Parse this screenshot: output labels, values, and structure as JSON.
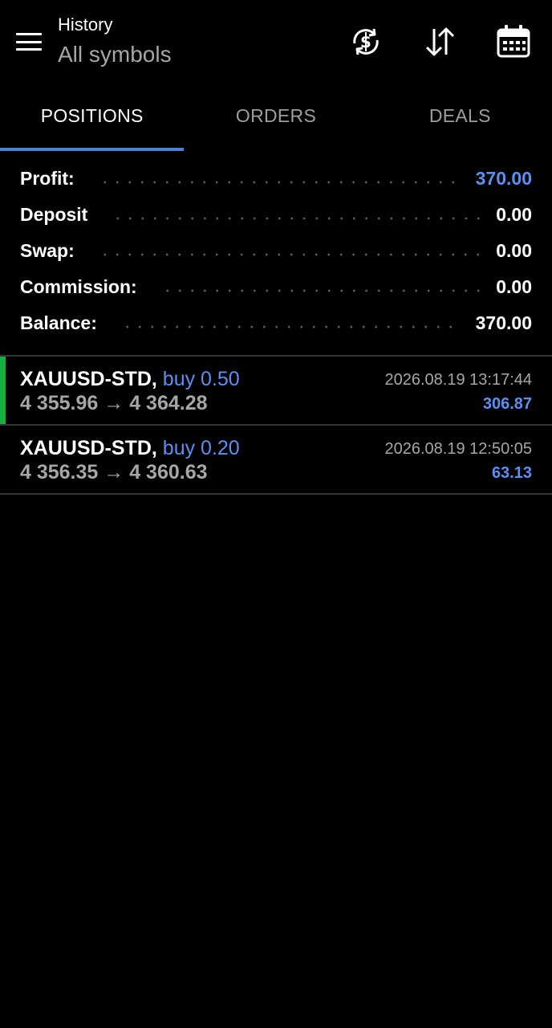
{
  "header": {
    "title": "History",
    "subtitle": "All symbols",
    "icons": [
      "menu-icon",
      "currency-refresh-icon",
      "sort-icon",
      "calendar-icon"
    ]
  },
  "tabs": [
    {
      "label": "POSITIONS",
      "active": true
    },
    {
      "label": "ORDERS",
      "active": false
    },
    {
      "label": "DEALS",
      "active": false
    }
  ],
  "summary": [
    {
      "label": "Profit:",
      "value": "370.00",
      "color": "#5b8ff3"
    },
    {
      "label": "Deposit",
      "value": "0.00",
      "color": "#ffffff"
    },
    {
      "label": "Swap:",
      "value": "0.00",
      "color": "#ffffff"
    },
    {
      "label": "Commission:",
      "value": "0.00",
      "color": "#ffffff"
    },
    {
      "label": "Balance:",
      "value": "370.00",
      "color": "#ffffff"
    }
  ],
  "positions": [
    {
      "symbol": "XAUUSD-STD,",
      "type": "buy 0.50",
      "prices": "4 355.96 → 4 364.28",
      "time": "2026.08.19 13:17:44",
      "profit": "306.87",
      "indicator_color": "#17b23c"
    },
    {
      "symbol": "XAUUSD-STD,",
      "type": "buy 0.20",
      "prices": "4 356.35 → 4 360.63",
      "time": "2026.08.19 12:50:05",
      "profit": "63.13"
    }
  ],
  "colors": {
    "background": "#000000",
    "accent": "#5b8ff3",
    "tab_indicator": "#4f7fd6",
    "muted_text": "#a6a6a6",
    "profit_bar": "#17b23c"
  }
}
